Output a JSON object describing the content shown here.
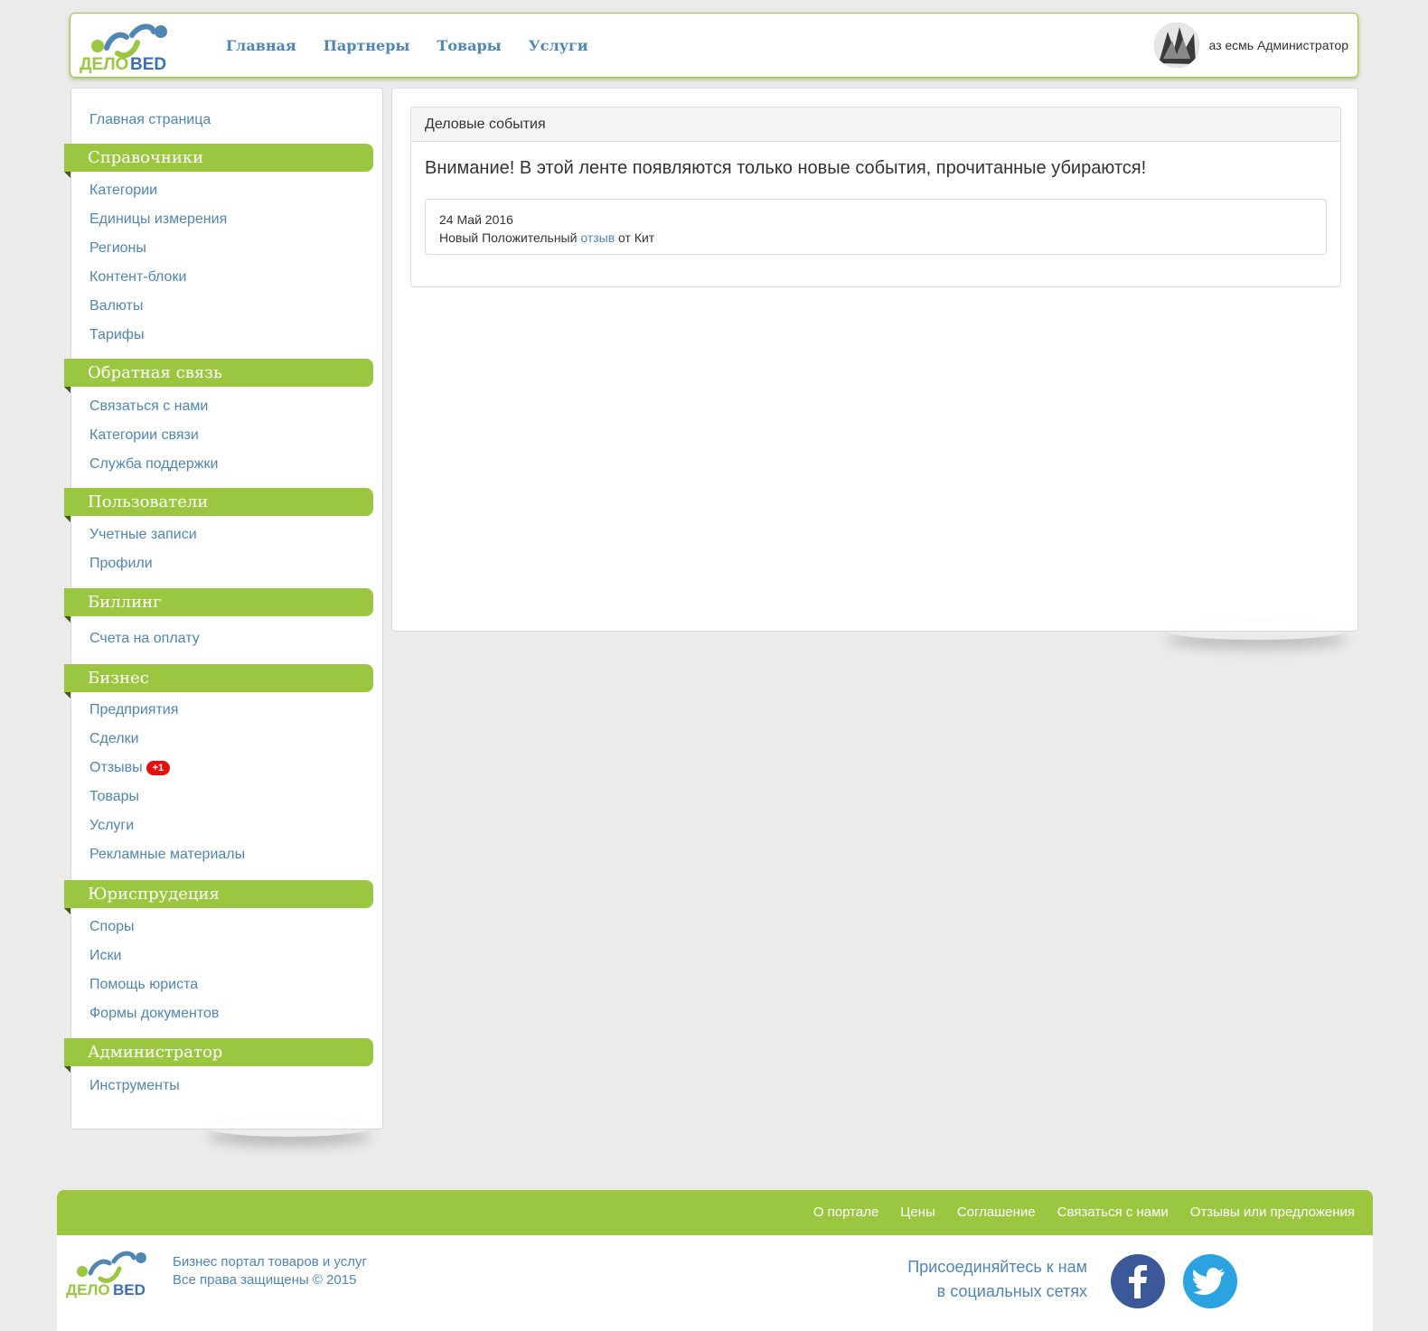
{
  "header": {
    "nav": [
      "Главная",
      "Партнеры",
      "Товары",
      "Услуги"
    ],
    "user_name": "аз есмь Администратор",
    "logo_text_left": "ДЕЛО",
    "logo_text_right": "ВЕD"
  },
  "sidebar": {
    "home": "Главная страница",
    "sections": [
      {
        "title": "Справочники",
        "items": [
          "Категории",
          "Единицы измерения",
          "Регионы",
          "Контент-блоки",
          "Валюты",
          "Тарифы"
        ]
      },
      {
        "title": "Обратная связь",
        "items": [
          "Связаться с нами",
          "Категории связи",
          "Служба поддержки"
        ]
      },
      {
        "title": "Пользователи",
        "items": [
          "Учетные записи",
          "Профили"
        ]
      },
      {
        "title": "Биллинг",
        "items": [
          "Счета на оплату"
        ]
      },
      {
        "title": "Бизнес",
        "items": [
          "Предприятия",
          "Сделки",
          "Отзывы",
          "Товары",
          "Услуги",
          "Рекламные материалы"
        ],
        "badge": "+1"
      },
      {
        "title": "Юриспрудеция",
        "items": [
          "Споры",
          "Иски",
          "Помощь юриста",
          "Формы документов"
        ]
      },
      {
        "title": "Администратор",
        "items": [
          "Инструменты"
        ]
      }
    ]
  },
  "main": {
    "panel_title": "Деловые события",
    "notice": "Внимание! В этой ленте появляются только новые события, прочитанные убираются!",
    "event": {
      "date": "24 Май 2016",
      "text_before": "Новый Положительный",
      "link": "отзыв",
      "text_after": "от Кит"
    }
  },
  "footer": {
    "links": [
      "О портале",
      "Цены",
      "Соглашение",
      "Связаться с нами",
      "Отзывы или предложения"
    ],
    "tagline": "Бизнес портал товаров и услуг",
    "copyright": "Все права защищены © 2015",
    "join_line1": "Присоединяйтесь к нам",
    "join_line2": "в социальных сетях"
  },
  "colors": {
    "accent_green": "#9bc640",
    "link_blue": "#4e86b4",
    "badge_red": "#e41010"
  }
}
